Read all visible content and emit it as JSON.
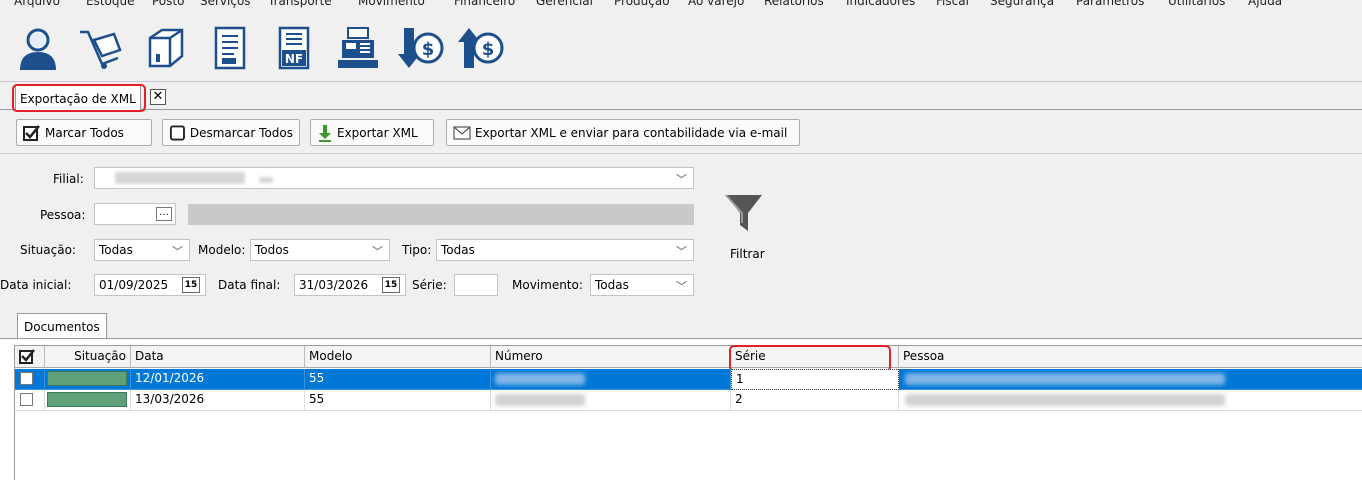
{
  "menu": [
    "Arquivo",
    "Estoque",
    "Posto",
    "Serviços",
    "Transporte",
    "Movimento",
    "Financeiro",
    "Gerencial",
    "Produção",
    "Ao varejo",
    "Relatórios",
    "Indicadores",
    "Fiscal",
    "Segurança",
    "Parâmetros",
    "Utilitários",
    "Ajuda"
  ],
  "toolbar_icons": [
    "person-icon",
    "cart-icon",
    "box-icon",
    "document-icon",
    "nfe-document-icon",
    "cash-register-icon",
    "money-down-icon",
    "money-up-icon"
  ],
  "doc_tab": {
    "title": "Exportação de XML",
    "close": "✕"
  },
  "actions": {
    "mark_all": "Marcar Todos",
    "unmark_all": "Desmarcar Todos",
    "export": "Exportar XML",
    "export_email": "Exportar XML e enviar para contabilidade via e-mail"
  },
  "filters": {
    "filial_label": "Filial:",
    "pessoa_label": "Pessoa:",
    "pessoa_button": "...",
    "situacao_label": "Situação:",
    "situacao_value": "Todas",
    "modelo_label": "Modelo:",
    "modelo_value": "Todos",
    "tipo_label": "Tipo:",
    "tipo_value": "Todas",
    "data_inicial_label": "Data inicial:",
    "data_inicial_value": "01/09/2025",
    "data_final_label": "Data final:",
    "data_final_value": "31/03/2026",
    "serie_label": "Série:",
    "movimento_label": "Movimento:",
    "movimento_value": "Todas",
    "calendar_label": "15",
    "filter_button": "Filtrar"
  },
  "documents": {
    "tab_label": "Documentos",
    "columns": [
      "Situação",
      "Data",
      "Modelo",
      "Número",
      "Série",
      "Pessoa"
    ],
    "rows": [
      {
        "data": "12/01/2026",
        "modelo": "55",
        "serie": "1",
        "selected": true
      },
      {
        "data": "13/03/2026",
        "modelo": "55",
        "serie": "2",
        "selected": false
      }
    ]
  },
  "colors": {
    "highlight": "#e0202a",
    "selection": "#0078d7",
    "status_green": "#5ea07a",
    "icon_blue": "#1c4f8c"
  }
}
